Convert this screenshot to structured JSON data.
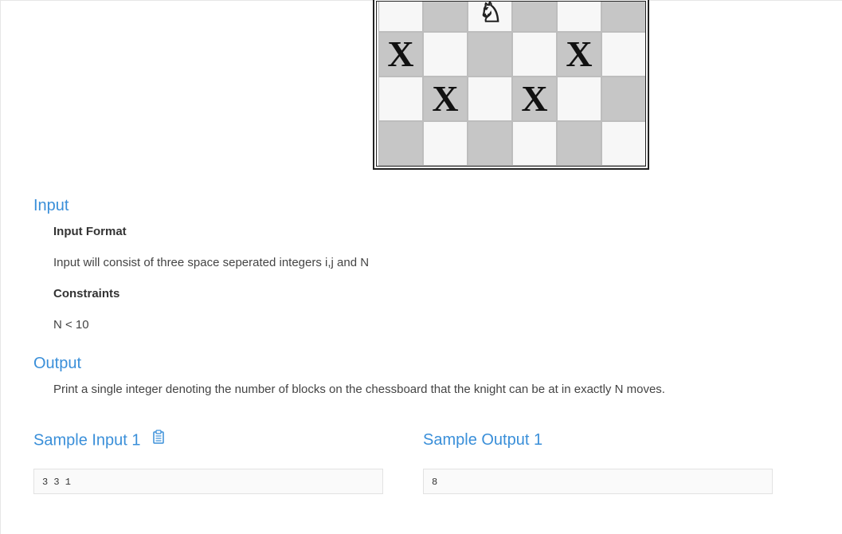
{
  "board": {
    "rows": [
      [
        "light",
        "dark",
        "light",
        "dark",
        "light",
        "dark"
      ],
      [
        "dark",
        "light",
        "dark",
        "light",
        "dark",
        "light"
      ],
      [
        "light",
        "dark",
        "light",
        "dark",
        "light",
        "dark"
      ],
      [
        "dark",
        "light",
        "dark",
        "light",
        "dark",
        "light"
      ]
    ],
    "marks": [
      {
        "row": 1,
        "col": 0,
        "symbol": "X"
      },
      {
        "row": 1,
        "col": 4,
        "symbol": "X"
      },
      {
        "row": 2,
        "col": 1,
        "symbol": "X"
      },
      {
        "row": 2,
        "col": 3,
        "symbol": "X"
      }
    ],
    "knight": {
      "row": 0,
      "col": 2,
      "symbol": "♘"
    }
  },
  "input": {
    "title": "Input",
    "format_heading": "Input Format",
    "format_text": "Input will consist of three space seperated integers i,j and N",
    "constraints_heading": "Constraints",
    "constraints_text": "N < 10"
  },
  "output": {
    "title": "Output",
    "text": "Print a single integer denoting the number of blocks on the chessboard that the knight can be at in exactly N moves."
  },
  "samples": {
    "input_title": "Sample Input 1",
    "input_value": "3 3 1",
    "output_title": "Sample Output 1",
    "output_value": "8",
    "copy_icon": "clipboard-icon"
  },
  "colors": {
    "heading": "#3a8fd9",
    "board_dark": "#c6c6c6",
    "board_light": "#f7f7f7"
  }
}
